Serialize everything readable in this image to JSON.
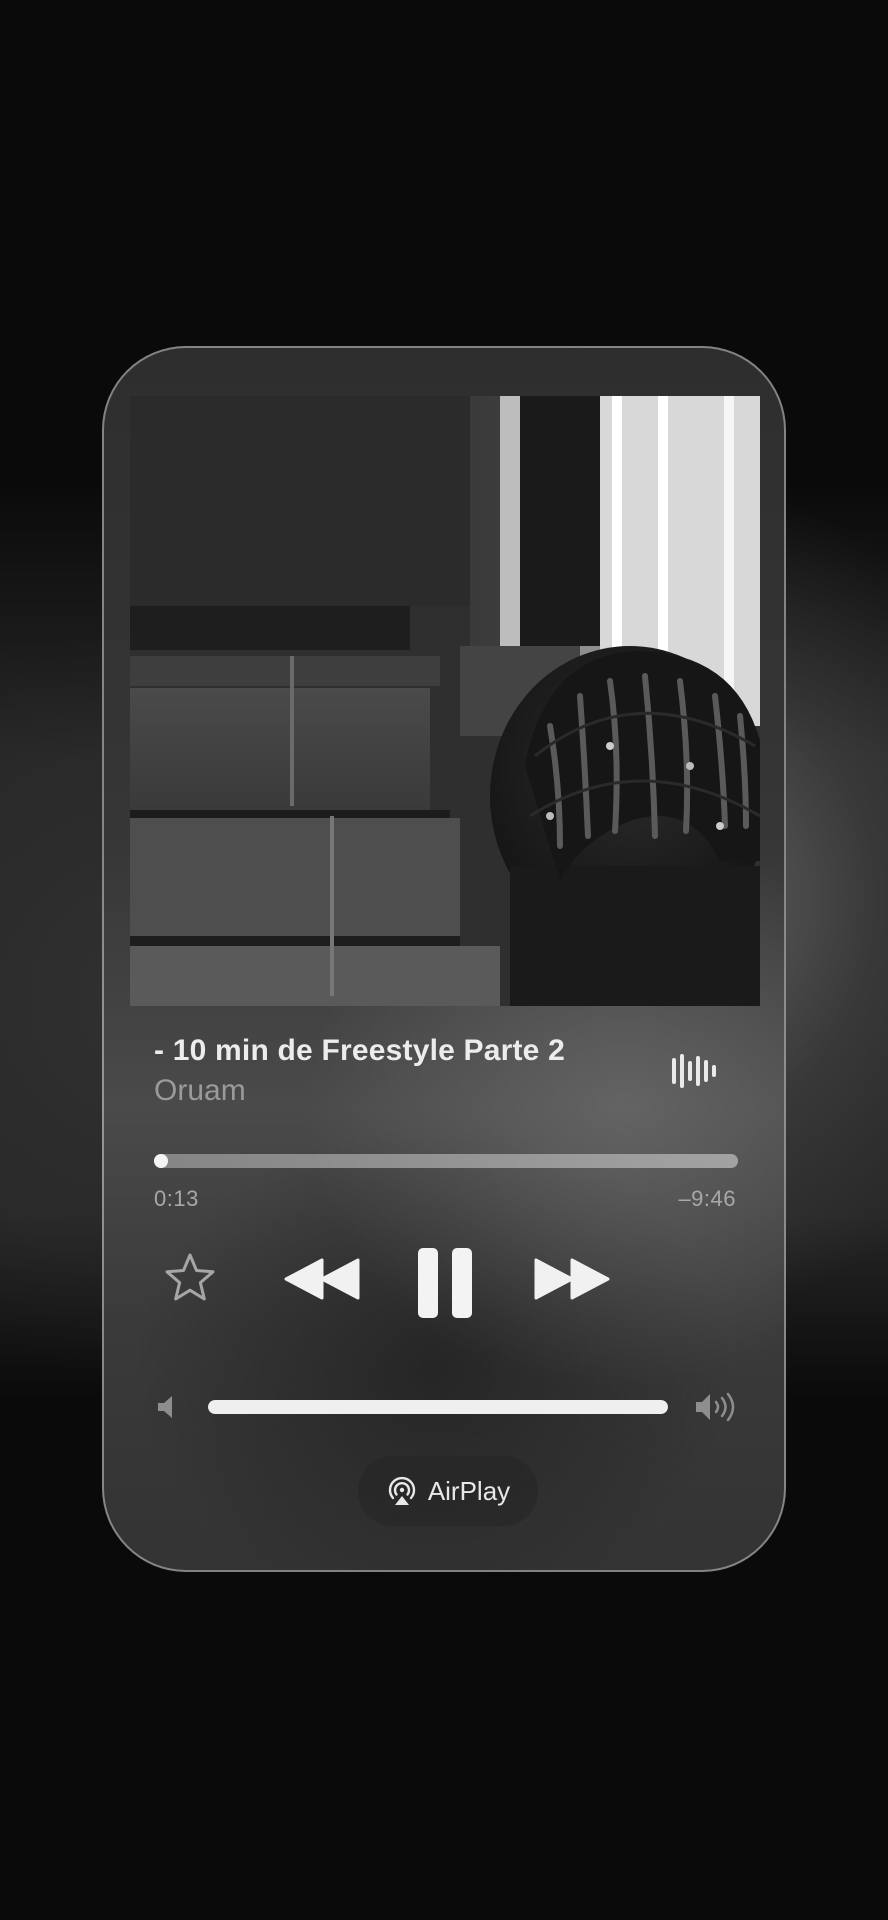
{
  "now_playing": {
    "title": "- 10 min de Freestyle Parte 2",
    "artist": "Oruam",
    "elapsed": "0:13",
    "remaining": "–9:46",
    "progress": 0.022,
    "volume": 1.0
  },
  "controls": {
    "favorite_icon": "star-icon",
    "previous_icon": "rewind-icon",
    "play_state_icon": "pause-icon",
    "next_icon": "fast-forward-icon",
    "waveform_icon": "waveform-icon",
    "volume_low_icon": "speaker-low-icon",
    "volume_high_icon": "speaker-high-icon"
  },
  "airplay": {
    "label": "AirPlay",
    "icon": "airplay-icon"
  }
}
